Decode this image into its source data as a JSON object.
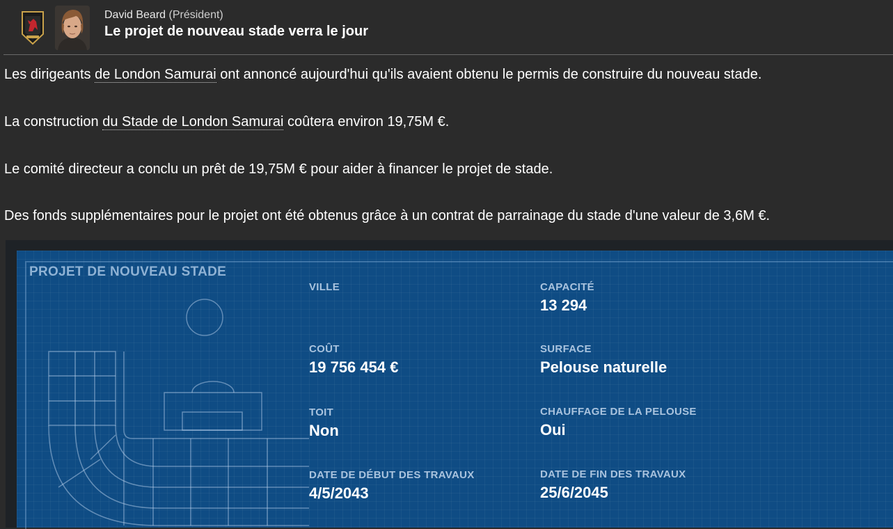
{
  "message": {
    "sender_name": "David Beard",
    "sender_role": "(Président)",
    "headline": "Le projet de nouveau stade verra le jour"
  },
  "body": {
    "p1_before": "Les dirigeants ",
    "p1_link": "de London Samurai",
    "p1_after": " ont annoncé aujourd'hui qu'ils avaient obtenu le permis de construire du nouveau stade.",
    "p2_before": "La construction ",
    "p2_link": "du Stade de London Samurai",
    "p2_after": " coûtera environ 19,75M €.",
    "p3": "Le comité directeur a conclu un prêt de 19,75M € pour aider à financer le projet de stade.",
    "p4": "Des fonds supplémentaires pour le projet ont été obtenus grâce à un contrat de parrainage du stade d'une valeur de 3,6M €."
  },
  "stadium_project": {
    "title": "PROJET DE NOUVEAU STADE",
    "fields": {
      "ville_label": "VILLE",
      "ville_value": "",
      "capacite_label": "CAPACITÉ",
      "capacite_value": "13 294",
      "cout_label": "COÛT",
      "cout_value": "19 756 454 €",
      "surface_label": "SURFACE",
      "surface_value": "Pelouse naturelle",
      "toit_label": "TOIT",
      "toit_value": "Non",
      "chauffage_label": "CHAUFFAGE DE LA PELOUSE",
      "chauffage_value": "Oui",
      "debut_label": "DATE DE DÉBUT DES TRAVAUX",
      "debut_value": "4/5/2043",
      "fin_label": "DATE DE FIN DES TRAVAUX",
      "fin_value": "25/6/2045"
    }
  },
  "colors": {
    "background": "#2b2b2b",
    "blueprint": "#0f4c84",
    "label": "#a9c3de"
  },
  "icons": {
    "crest": "club-crest-icon",
    "avatar": "president-avatar"
  }
}
